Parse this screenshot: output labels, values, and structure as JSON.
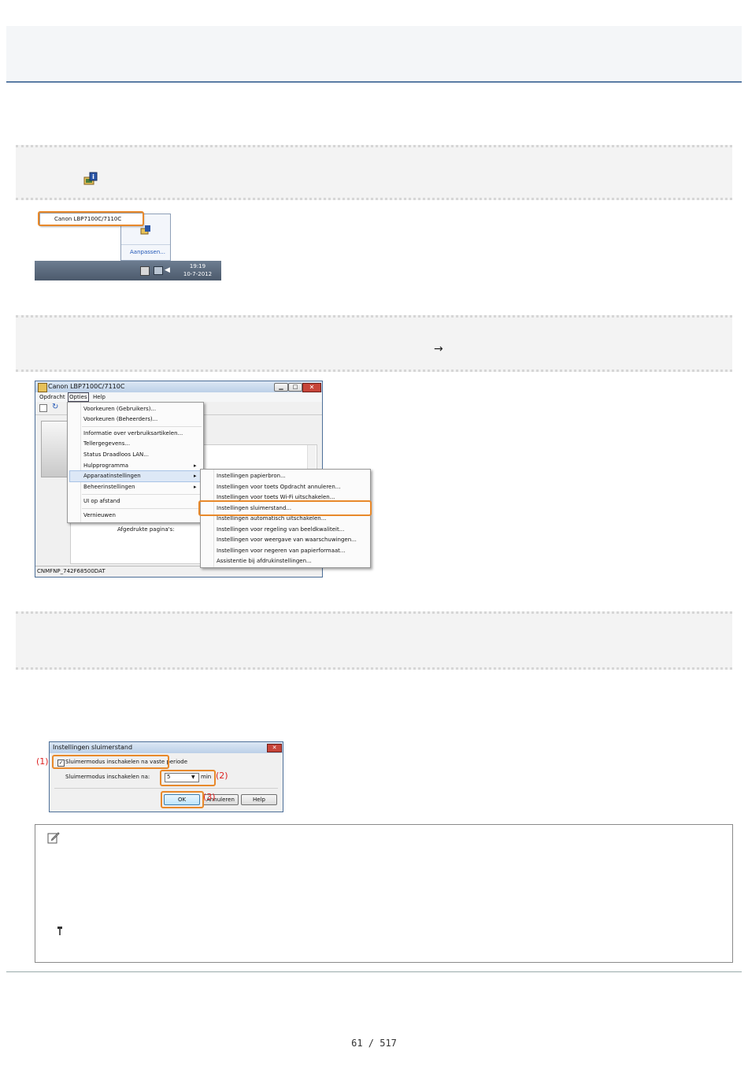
{
  "tray_popup": {
    "printer_name": "Canon LBP7100C/7110C",
    "customize_link": "Aanpassen...",
    "clock_time": "19:19",
    "clock_date": "10-7-2012"
  },
  "arrow_symbol": "→",
  "printer_window": {
    "title": "Canon LBP7100C/7110C",
    "menubar": [
      "Opdracht",
      "Opties",
      "Help"
    ],
    "options_menu": [
      "Voorkeuren (Gebruikers)...",
      "Voorkeuren (Beheerders)...",
      "Informatie over verbruiksartikelen...",
      "Tellergegevens...",
      "Status Draadloos LAN...",
      "Hulpprogramma",
      "Apparaatinstellingen",
      "Beheerinstellingen",
      "UI op afstand",
      "Vernieuwen"
    ],
    "device_submenu": [
      "Instellingen papierbron...",
      "Instellingen voor toets Opdracht annuleren...",
      "Instellingen voor toets Wi-Fi uitschakelen...",
      "Instellingen sluimerstand...",
      "Instellingen automatisch uitschakelen...",
      "Instellingen voor regeling van beeldkwaliteit...",
      "Instellingen voor weergave van waarschuwingen...",
      "Instellingen voor negeren van papierformaat...",
      "Assistentie bij afdrukinstellingen..."
    ],
    "printed_pages_label": "Afgedrukte pagina's:",
    "status_bar": "CNMFNP_742F68500DAT"
  },
  "sleep_dialog": {
    "title": "Instellingen sluimerstand",
    "checkbox_label": "Sluimermodus inschakelen na vaste periode",
    "row_label": "Sluimermodus inschakelen na:",
    "value": "5",
    "unit": "min",
    "ok": "OK",
    "cancel": "Annuleren",
    "help": "Help",
    "callouts": [
      "(1)",
      "(2)",
      "(3)"
    ]
  },
  "page_number": "61 / 517",
  "colors": {
    "highlight": "#e8892b",
    "rule": "#5b7ca5",
    "callout": "#dd2222"
  }
}
